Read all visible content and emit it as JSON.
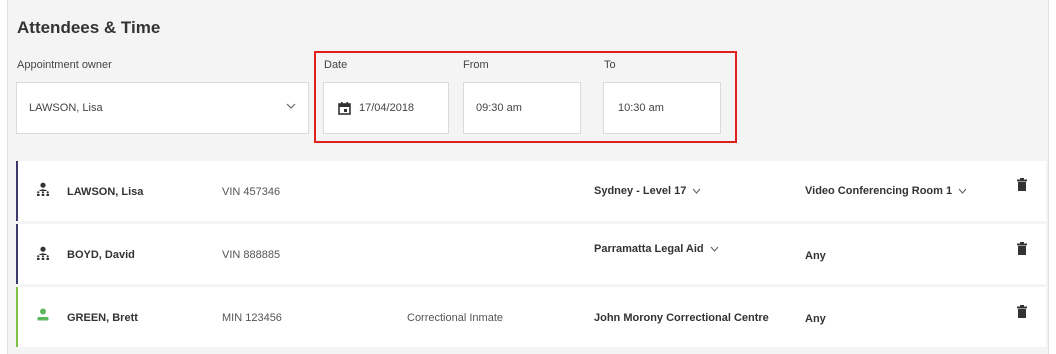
{
  "section": {
    "title": "Attendees & Time"
  },
  "owner": {
    "label": "Appointment owner",
    "value": "LAWSON, Lisa"
  },
  "date": {
    "label": "Date",
    "value": "17/04/2018"
  },
  "from": {
    "label": "From",
    "value": "09:30 am"
  },
  "to": {
    "label": "To",
    "value": "10:30 am"
  },
  "attendees": [
    {
      "name": "LAWSON, Lisa",
      "id": "VIN 457346",
      "type": "",
      "location": "Sydney - Level 17",
      "room": "Video Conferencing Room 1"
    },
    {
      "name": "BOYD, David",
      "id": "VIN 888885",
      "type": "",
      "location": "Parramatta Legal Aid",
      "room": "Any"
    },
    {
      "name": "GREEN, Brett",
      "id": "MIN 123456",
      "type": "Correctional Inmate",
      "location": "John Morony Correctional Centre",
      "room": "Any"
    }
  ],
  "colors": {
    "highlight": "#e0201b",
    "staff_bar": "#3c3a6b",
    "inmate_bar": "#7dc243",
    "inmate_icon": "#5cb85c"
  },
  "icons": {
    "staff": "group-person-icon",
    "inmate": "person-icon",
    "calendar": "calendar-icon",
    "dropdown": "chevron-down-icon",
    "delete": "trash-icon"
  }
}
